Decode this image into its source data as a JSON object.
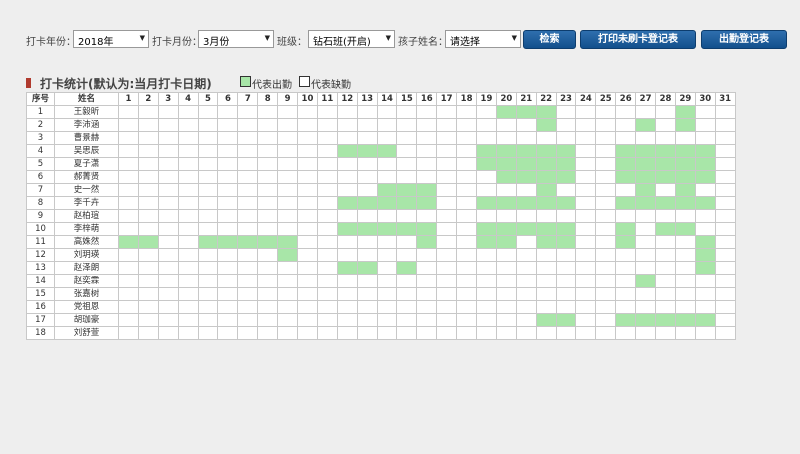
{
  "filters": {
    "year_label": "打卡年份：",
    "year_value": "2018年",
    "month_label": "打卡月份：",
    "month_value": "3月份",
    "class_label": "班级：",
    "class_value": "钻石班(开启)",
    "child_label": "孩子姓名：",
    "child_value": "请选择"
  },
  "buttons": {
    "search": "检索",
    "print_unpunched": "打印未刷卡登记表",
    "attendance_register": "出勤登记表"
  },
  "section": {
    "title": "打卡统计(默认为:当月打卡日期)",
    "legend_present": "代表出勤",
    "legend_absent": "代表缺勤",
    "present_color": "#a8e6a8",
    "accent_color": "#b03a2e"
  },
  "table": {
    "col_index": "序号",
    "col_name": "姓名",
    "days": [
      "1",
      "2",
      "3",
      "4",
      "5",
      "6",
      "7",
      "8",
      "9",
      "10",
      "11",
      "12",
      "13",
      "14",
      "15",
      "16",
      "17",
      "18",
      "19",
      "20",
      "21",
      "22",
      "23",
      "24",
      "25",
      "26",
      "27",
      "28",
      "29",
      "30",
      "31"
    ],
    "rows": [
      {
        "index": "1",
        "name": "王毅昕",
        "present": [
          20,
          21,
          22,
          29
        ]
      },
      {
        "index": "2",
        "name": "李沛涵",
        "present": [
          22,
          27,
          29
        ]
      },
      {
        "index": "3",
        "name": "曹景赫",
        "present": []
      },
      {
        "index": "4",
        "name": "吴思辰",
        "present": [
          12,
          13,
          14,
          19,
          20,
          21,
          22,
          23,
          26,
          27,
          28,
          29,
          30
        ]
      },
      {
        "index": "5",
        "name": "夏子潇",
        "present": [
          19,
          20,
          21,
          22,
          23,
          26,
          27,
          28,
          29,
          30
        ]
      },
      {
        "index": "6",
        "name": "郝菁贤",
        "present": [
          20,
          21,
          22,
          23,
          26,
          27,
          28,
          29,
          30
        ]
      },
      {
        "index": "7",
        "name": "史一然",
        "present": [
          14,
          15,
          16,
          22,
          27,
          29
        ]
      },
      {
        "index": "8",
        "name": "李千卉",
        "present": [
          12,
          13,
          14,
          15,
          16,
          19,
          20,
          21,
          22,
          23,
          26,
          27,
          28,
          29,
          30
        ]
      },
      {
        "index": "9",
        "name": "赵柏瑄",
        "present": []
      },
      {
        "index": "10",
        "name": "李梓萌",
        "present": [
          12,
          13,
          14,
          15,
          16,
          19,
          20,
          21,
          22,
          23,
          26,
          28,
          29
        ]
      },
      {
        "index": "11",
        "name": "高姝然",
        "present": [
          1,
          2,
          5,
          6,
          7,
          8,
          9,
          16,
          19,
          20,
          22,
          23,
          26,
          30
        ]
      },
      {
        "index": "12",
        "name": "刘玥瑛",
        "present": [
          9,
          30
        ]
      },
      {
        "index": "13",
        "name": "赵泽朗",
        "present": [
          12,
          13,
          15,
          30
        ]
      },
      {
        "index": "14",
        "name": "赵奕霖",
        "present": [
          27
        ]
      },
      {
        "index": "15",
        "name": "张嘉树",
        "present": []
      },
      {
        "index": "16",
        "name": "党祖恩",
        "present": []
      },
      {
        "index": "17",
        "name": "胡珈豪",
        "present": [
          22,
          23,
          26,
          27,
          28,
          29,
          30
        ]
      },
      {
        "index": "18",
        "name": "刘舒萱",
        "present": []
      }
    ]
  }
}
